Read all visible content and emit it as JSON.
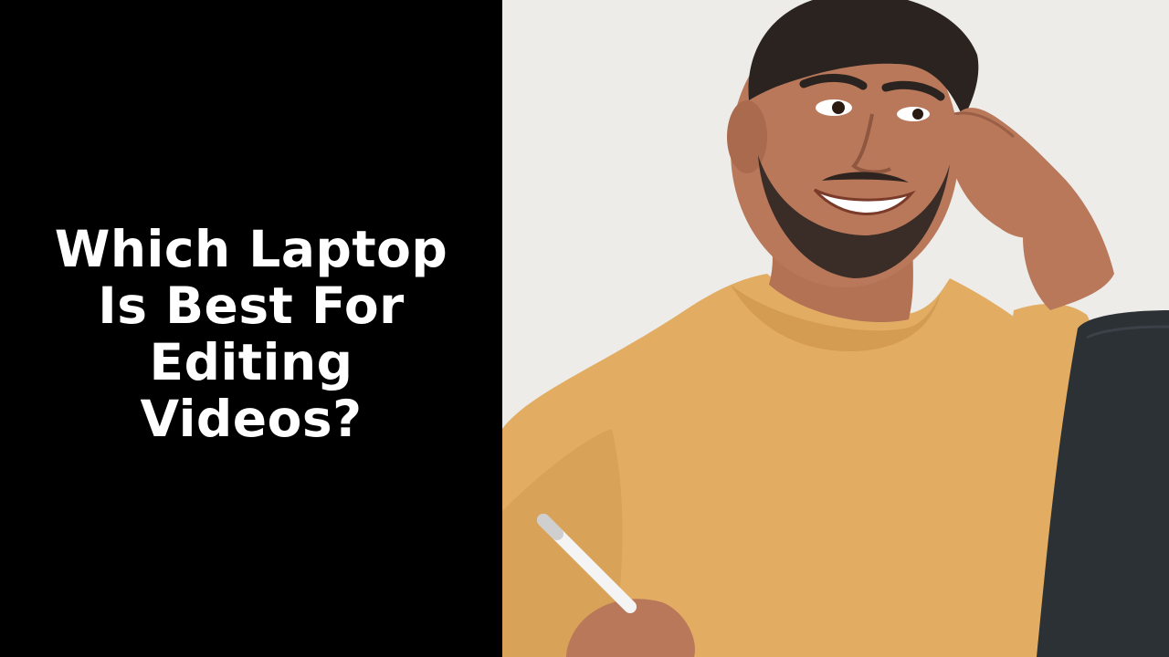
{
  "headline": {
    "line1": "Which Laptop",
    "line2": "Is Best For",
    "line3": "Editing",
    "line4": "Videos?"
  },
  "colors": {
    "panel_background": "#000000",
    "headline_text": "#ffffff",
    "photo_background": "#edece9",
    "shirt": "#e2ad63",
    "skin": "#b9785a",
    "hair": "#2a2320",
    "laptop": "#2c3136"
  },
  "photo": {
    "subject": "smiling man in a mustard t-shirt holding a pen, touching his temple, next to a laptop"
  }
}
